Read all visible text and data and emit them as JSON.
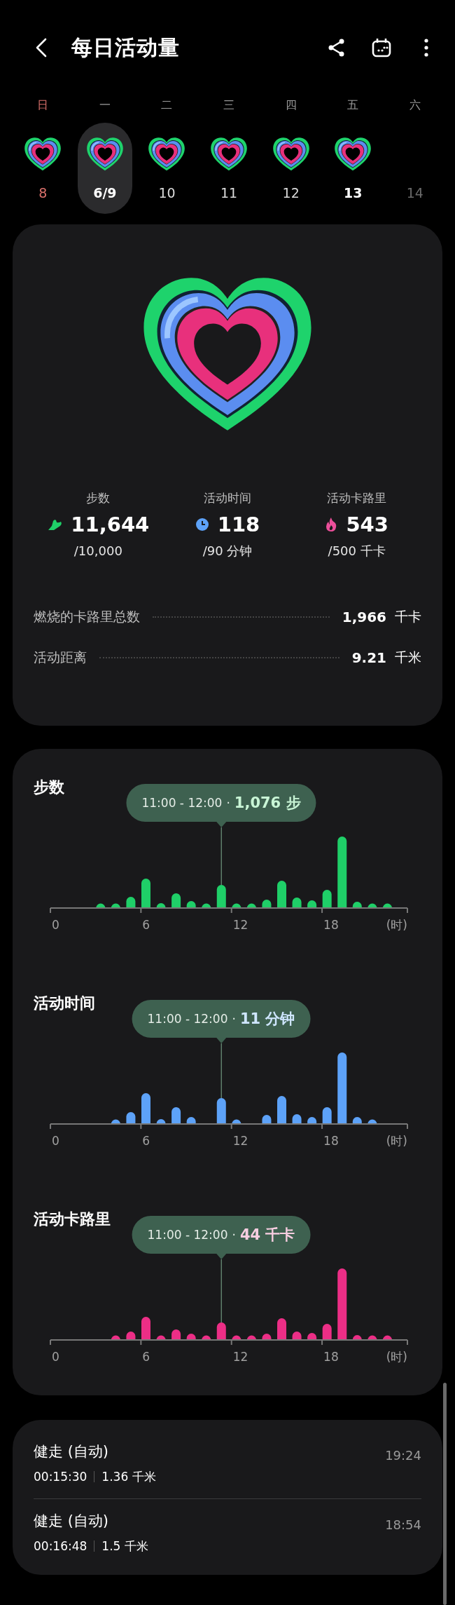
{
  "header": {
    "title": "每日活动量"
  },
  "week": {
    "days": [
      {
        "weekday": "日",
        "date": "8",
        "selected": false,
        "sunday": true,
        "today": false,
        "future": false
      },
      {
        "weekday": "一",
        "date": "6/9",
        "selected": true,
        "sunday": false,
        "today": false,
        "future": false
      },
      {
        "weekday": "二",
        "date": "10",
        "selected": false,
        "sunday": false,
        "today": false,
        "future": false
      },
      {
        "weekday": "三",
        "date": "11",
        "selected": false,
        "sunday": false,
        "today": false,
        "future": false
      },
      {
        "weekday": "四",
        "date": "12",
        "selected": false,
        "sunday": false,
        "today": false,
        "future": false
      },
      {
        "weekday": "五",
        "date": "13",
        "selected": false,
        "sunday": false,
        "today": true,
        "future": false
      },
      {
        "weekday": "六",
        "date": "14",
        "selected": false,
        "sunday": false,
        "today": false,
        "future": true
      }
    ]
  },
  "summary": {
    "stats": [
      {
        "kind": "steps",
        "label": "步数",
        "value": "11,644",
        "goal": "/10,000"
      },
      {
        "kind": "time",
        "label": "活动时间",
        "value": "118",
        "goal": "/90 分钟"
      },
      {
        "kind": "calories",
        "label": "活动卡路里",
        "value": "543",
        "goal": "/500 千卡"
      }
    ],
    "totals": [
      {
        "label": "燃烧的卡路里总数",
        "value": "1,966",
        "unit": "千卡"
      },
      {
        "label": "活动距离",
        "value": "9.21",
        "unit": "千米"
      }
    ]
  },
  "charts": [
    {
      "kind": "steps",
      "title": "步数",
      "tooltip": {
        "time": "11:00 - 12:00",
        "separator": "·",
        "value": "1,076 步"
      },
      "axis": [
        "0",
        "6",
        "12",
        "18",
        "(时)"
      ]
    },
    {
      "kind": "time",
      "title": "活动时间",
      "tooltip": {
        "time": "11:00 - 12:00",
        "separator": "·",
        "value": "11 分钟"
      },
      "axis": [
        "0",
        "6",
        "12",
        "18",
        "(时)"
      ]
    },
    {
      "kind": "calories",
      "title": "活动卡路里",
      "tooltip": {
        "time": "11:00 - 12:00",
        "separator": "·",
        "value": "44 千卡"
      },
      "axis": [
        "0",
        "6",
        "12",
        "18",
        "(时)"
      ]
    }
  ],
  "workouts": [
    {
      "name": "健走 (自动)",
      "duration": "00:15:30",
      "distance": "1.36 千米",
      "time": "19:24"
    },
    {
      "name": "健走 (自动)",
      "duration": "00:16:48",
      "distance": "1.5 千米",
      "time": "18:54"
    }
  ]
}
